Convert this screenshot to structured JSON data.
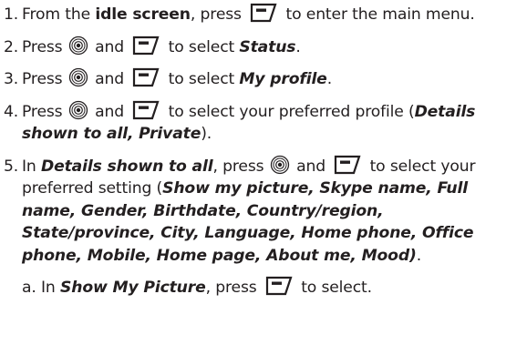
{
  "steps": [
    {
      "num": "1.",
      "t1": "From the ",
      "b1": "idle screen",
      "t2": ", press",
      "t3": "to enter the main menu."
    },
    {
      "num": "2.",
      "t1": "Press",
      "t2": "and",
      "t3": "to select ",
      "e1": "Status",
      "t4": "."
    },
    {
      "num": "3.",
      "t1": "Press",
      "t2": "and",
      "t3": "to select ",
      "e1": "My profile",
      "t4": "."
    },
    {
      "num": "4.",
      "t1": "Press",
      "t2": "and",
      "t3": "to select your preferred profile (",
      "e1": "Details shown to all, Private",
      "t4": ")."
    },
    {
      "num": "5.",
      "t1": "In ",
      "e1": "Details shown to all",
      "t2": ", press",
      "t3": "and",
      "t4": "to select your preferred setting (",
      "e2": "Show my picture, Skype name, Full name, Gender, Birthdate, Country/region, State/province, City, Language, Home phone, Office phone, Mobile, Home page, About me, Mood)",
      "t5": "."
    }
  ],
  "substep": {
    "num": "a.",
    "t1": "In ",
    "e1": "Show My Picture",
    "t2": ", press",
    "t3": "to select."
  },
  "icons": {
    "softkey": "left-softkey-icon",
    "nav": "navigation-key-icon"
  },
  "colors": {
    "text": "#231f20"
  }
}
